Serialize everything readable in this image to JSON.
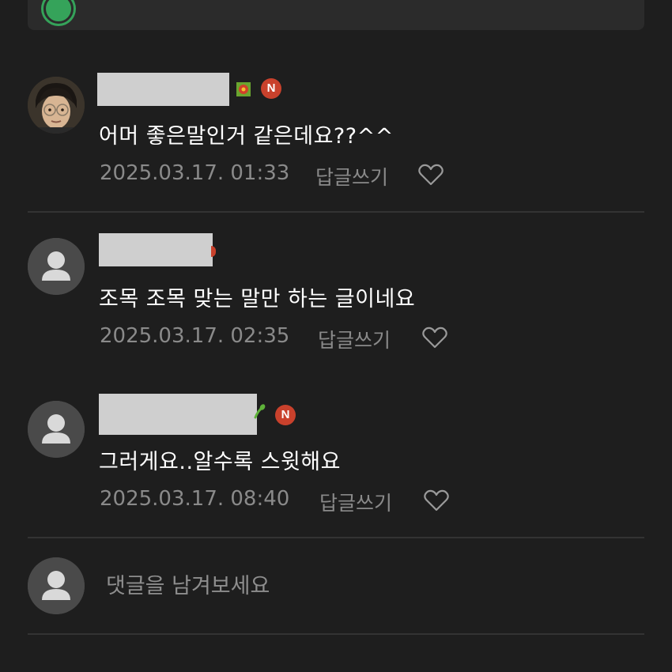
{
  "banner": {
    "icon": "green-circle-icon"
  },
  "comments": [
    {
      "avatar": "photo-avatar",
      "level_icon": "red-flower-icon",
      "new_badge": "N",
      "text": "어머 좋은말인거 같은데요??^^",
      "date": "2025.03.17. 01:33",
      "reply_label": "답글쓰기"
    },
    {
      "avatar": "default-avatar",
      "level_icon": "",
      "new_badge": "",
      "text": "조목 조목 맞는 말만 하는 글이네요",
      "date": "2025.03.17. 02:35",
      "reply_label": "답글쓰기"
    },
    {
      "avatar": "default-avatar",
      "level_icon": "green-sprout-icon",
      "new_badge": "N",
      "text": "그러게요..알수록 스윗해요",
      "date": "2025.03.17. 08:40",
      "reply_label": "답글쓰기"
    }
  ],
  "composer": {
    "placeholder": "댓글을 남겨보세요"
  },
  "colors": {
    "background": "#1e1e1e",
    "divider": "#333333",
    "meta_text": "#8a8a8a",
    "new_badge": "#c9412c"
  }
}
